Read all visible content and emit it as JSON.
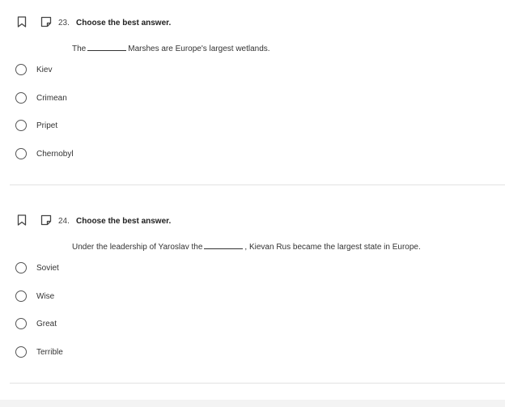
{
  "questions": [
    {
      "number": "23.",
      "instruction": "Choose the best answer.",
      "prompt_before": "The",
      "prompt_after": "Marshes are Europe's largest wetlands.",
      "options": [
        "Kiev",
        "Crimean",
        "Pripet",
        "Chernobyl"
      ]
    },
    {
      "number": "24.",
      "instruction": "Choose the best answer.",
      "prompt_before": "Under the leadership of Yaroslav the",
      "prompt_after": ", Kievan Rus became the largest state in Europe.",
      "options": [
        "Soviet",
        "Wise",
        "Great",
        "Terrible"
      ]
    }
  ],
  "icons": {
    "bookmark": "bookmark-icon",
    "note": "note-icon"
  },
  "colors": {
    "divider": "#e2e2e2",
    "text": "#333333"
  }
}
